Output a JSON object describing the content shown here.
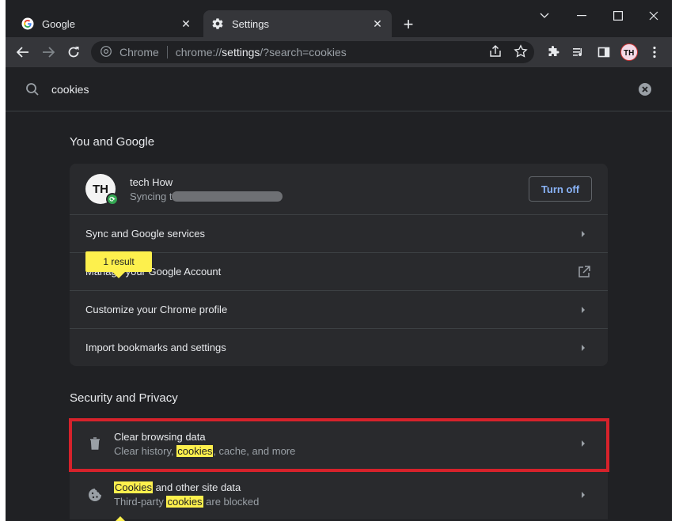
{
  "tabs": [
    {
      "title": "Google",
      "active": false,
      "icon": "google-icon"
    },
    {
      "title": "Settings",
      "active": true,
      "icon": "gear-icon"
    }
  ],
  "omnibox": {
    "site_label": "Chrome",
    "url_scheme": "chrome://",
    "url_host": "settings",
    "url_rest": "/?search=cookies"
  },
  "search": {
    "value": "cookies"
  },
  "you_and_google": {
    "title": "You and Google",
    "profile_name": "tech How",
    "profile_sub": "Syncing t",
    "avatar_initials": "TH",
    "turn_off_label": "Turn off",
    "items": [
      {
        "label": "Sync and Google services"
      },
      {
        "label": "Manage your Google Account"
      },
      {
        "label": "Customize your Chrome profile"
      },
      {
        "label": "Import bookmarks and settings"
      }
    ]
  },
  "tooltip": {
    "label": "1 result"
  },
  "security_privacy": {
    "title": "Security and Privacy",
    "clear_browsing": {
      "title": "Clear browsing data",
      "sub_before": "Clear history, ",
      "sub_hl": "cookies",
      "sub_after": ", cache, and more"
    },
    "cookies_site": {
      "title_hl": "Cookies",
      "title_after": " and other site data",
      "sub_before": "Third-party ",
      "sub_hl": "cookies",
      "sub_after": " are blocked"
    }
  },
  "colors": {
    "accent": "#8ab4f8",
    "highlight": "#fdf04d",
    "frame": "#d6222b"
  }
}
